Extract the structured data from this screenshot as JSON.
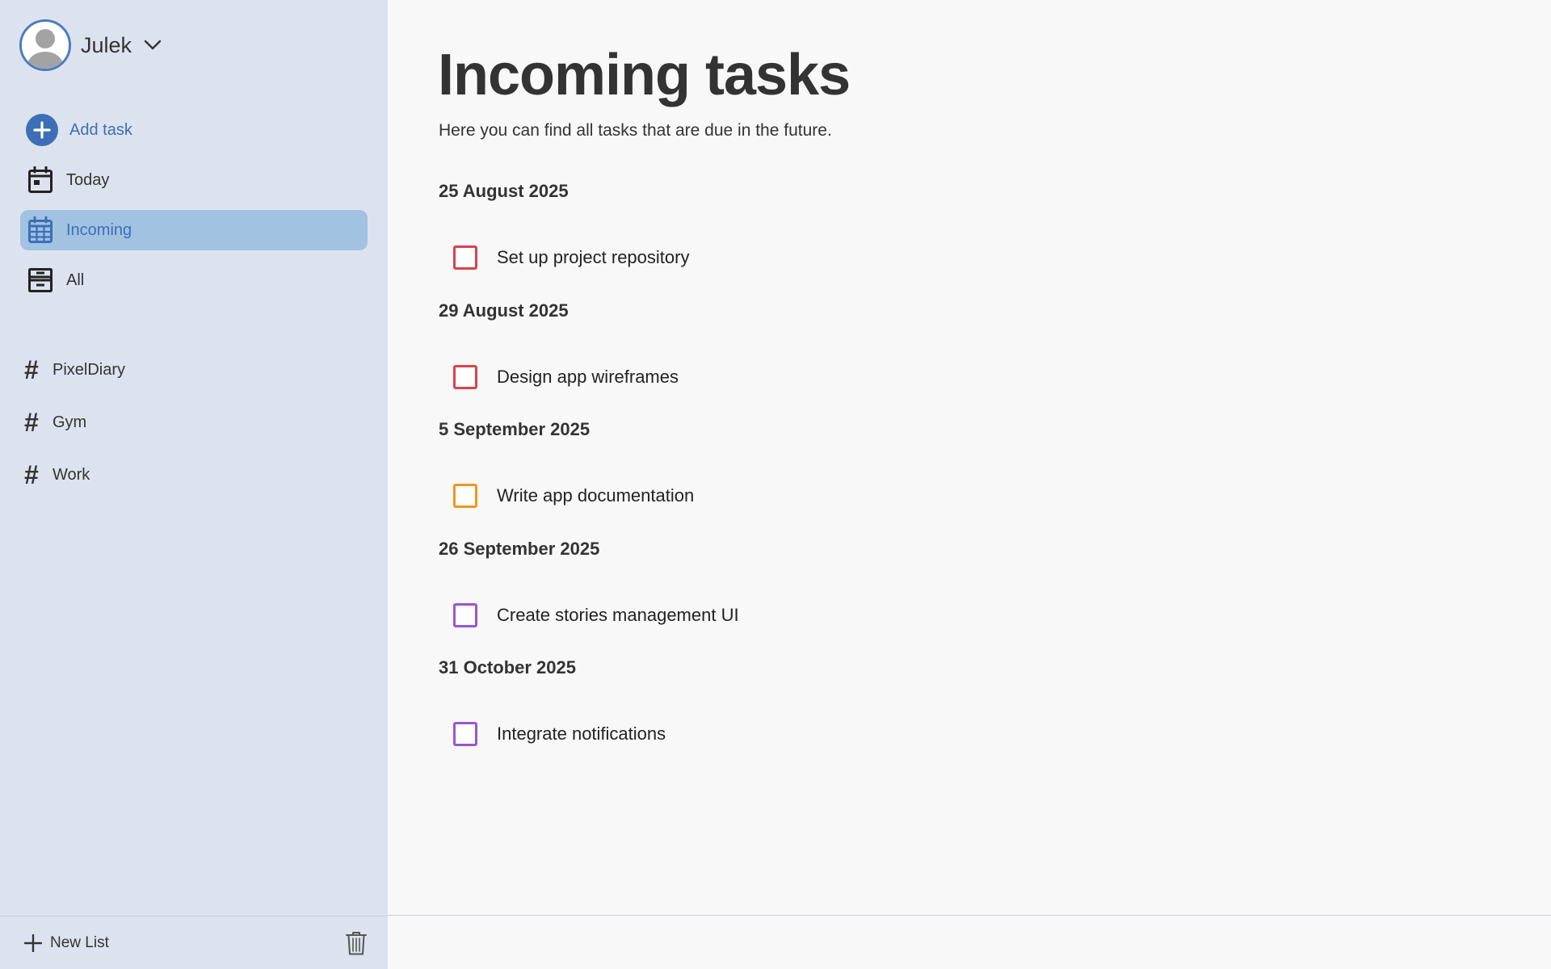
{
  "user": {
    "name": "Julek"
  },
  "nav": {
    "add_task": "Add task",
    "today": "Today",
    "incoming": "Incoming",
    "all": "All"
  },
  "lists": [
    {
      "name": "PixelDiary"
    },
    {
      "name": "Gym"
    },
    {
      "name": "Work"
    }
  ],
  "footer": {
    "new_list": "New List"
  },
  "main": {
    "title": "Incoming tasks",
    "subtitle": "Here you can find all tasks that are due in the future."
  },
  "groups": [
    {
      "date": "25 August 2025",
      "task": {
        "title": "Set up project repository",
        "priority_color": "#d9434b"
      }
    },
    {
      "date": "29 August 2025",
      "task": {
        "title": "Design app wireframes",
        "priority_color": "#d9434b"
      }
    },
    {
      "date": "5 September 2025",
      "task": {
        "title": "Write app documentation",
        "priority_color": "#f0961e"
      }
    },
    {
      "date": "26 September 2025",
      "task": {
        "title": "Create stories management UI",
        "priority_color": "#9a55d6"
      }
    },
    {
      "date": "31 October 2025",
      "task": {
        "title": "Integrate notifications",
        "priority_color": "#9a55d6"
      }
    }
  ],
  "colors": {
    "accent": "#3d6fb6",
    "sidebar_bg": "#dce3ef",
    "active_item_bg": "#a2c2e2",
    "main_bg": "#f9f8f8"
  },
  "icons": {
    "user_menu": "chevron-down-icon",
    "add_task": "plus-circle-icon",
    "today": "calendar-day-icon",
    "incoming": "calendar-grid-icon",
    "all": "archive-icon",
    "list": "hash-icon",
    "new_list": "plus-icon",
    "delete": "trash-icon"
  }
}
